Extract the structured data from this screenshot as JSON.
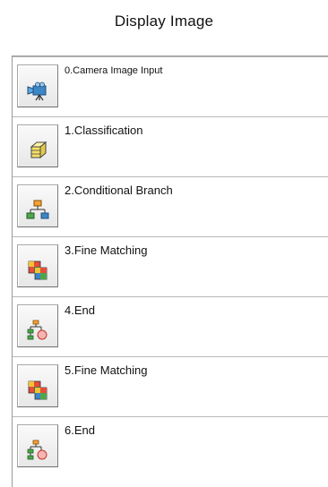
{
  "window": {
    "title": "Display Image"
  },
  "flow": {
    "items": [
      {
        "label": "0.Camera Image Input",
        "icon": "camera-icon"
      },
      {
        "label": "1.Classification",
        "icon": "classification-icon"
      },
      {
        "label": "2.Conditional Branch",
        "icon": "branch-icon"
      },
      {
        "label": "3.Fine Matching",
        "icon": "fine-matching-icon"
      },
      {
        "label": "4.End",
        "icon": "end-icon"
      },
      {
        "label": "5.Fine Matching",
        "icon": "fine-matching-icon"
      },
      {
        "label": "6.End",
        "icon": "end-icon"
      }
    ]
  },
  "colors": {
    "row_divider": "#b8b8b8",
    "list_border": "#9a9a9a",
    "button_face": "#f0f0f0"
  }
}
